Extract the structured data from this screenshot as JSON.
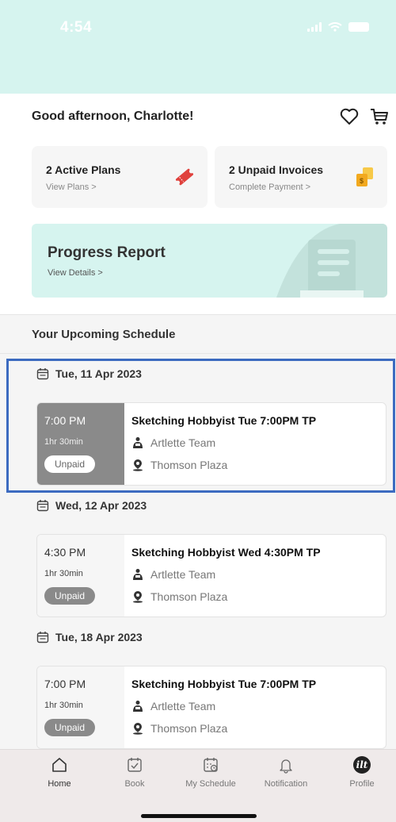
{
  "status_bar": {
    "time": "4:54"
  },
  "header": {
    "greeting": "Good afternoon, Charlotte!"
  },
  "cards": {
    "plans": {
      "title": "2 Active Plans",
      "link": "View Plans >"
    },
    "invoices": {
      "title": "2 Unpaid Invoices",
      "link": "Complete Payment >"
    }
  },
  "progress": {
    "title": "Progress Report",
    "link": "View Details >"
  },
  "schedule": {
    "section_title": "Your Upcoming Schedule",
    "days": [
      {
        "date": "Tue, 11 Apr 2023",
        "session": {
          "time": "7:00 PM",
          "duration": "1hr 30min",
          "status": "Unpaid",
          "title": "Sketching Hobbyist Tue 7:00PM TP",
          "team": "Artlette Team",
          "location": "Thomson Plaza"
        }
      },
      {
        "date": "Wed, 12 Apr 2023",
        "session": {
          "time": "4:30 PM",
          "duration": "1hr 30min",
          "status": "Unpaid",
          "title": "Sketching Hobbyist Wed 4:30PM TP",
          "team": "Artlette Team",
          "location": "Thomson Plaza"
        }
      },
      {
        "date": "Tue, 18 Apr 2023",
        "session": {
          "time": "7:00 PM",
          "duration": "1hr 30min",
          "status": "Unpaid",
          "title": "Sketching Hobbyist Tue 7:00PM TP",
          "team": "Artlette Team",
          "location": "Thomson Plaza"
        }
      }
    ]
  },
  "nav": {
    "items": [
      {
        "label": "Home",
        "icon": "home-icon"
      },
      {
        "label": "Book",
        "icon": "calendar-check-icon"
      },
      {
        "label": "My Schedule",
        "icon": "schedule-icon"
      },
      {
        "label": "Notification",
        "icon": "bell-icon"
      },
      {
        "label": "Profile",
        "icon": "avatar-icon"
      }
    ],
    "avatar_text": "ilt"
  },
  "colors": {
    "header_bg": "#d6f4ef",
    "highlight": "#3c6bc0",
    "ticket": "#e0413d",
    "coins": "#f2b630"
  }
}
